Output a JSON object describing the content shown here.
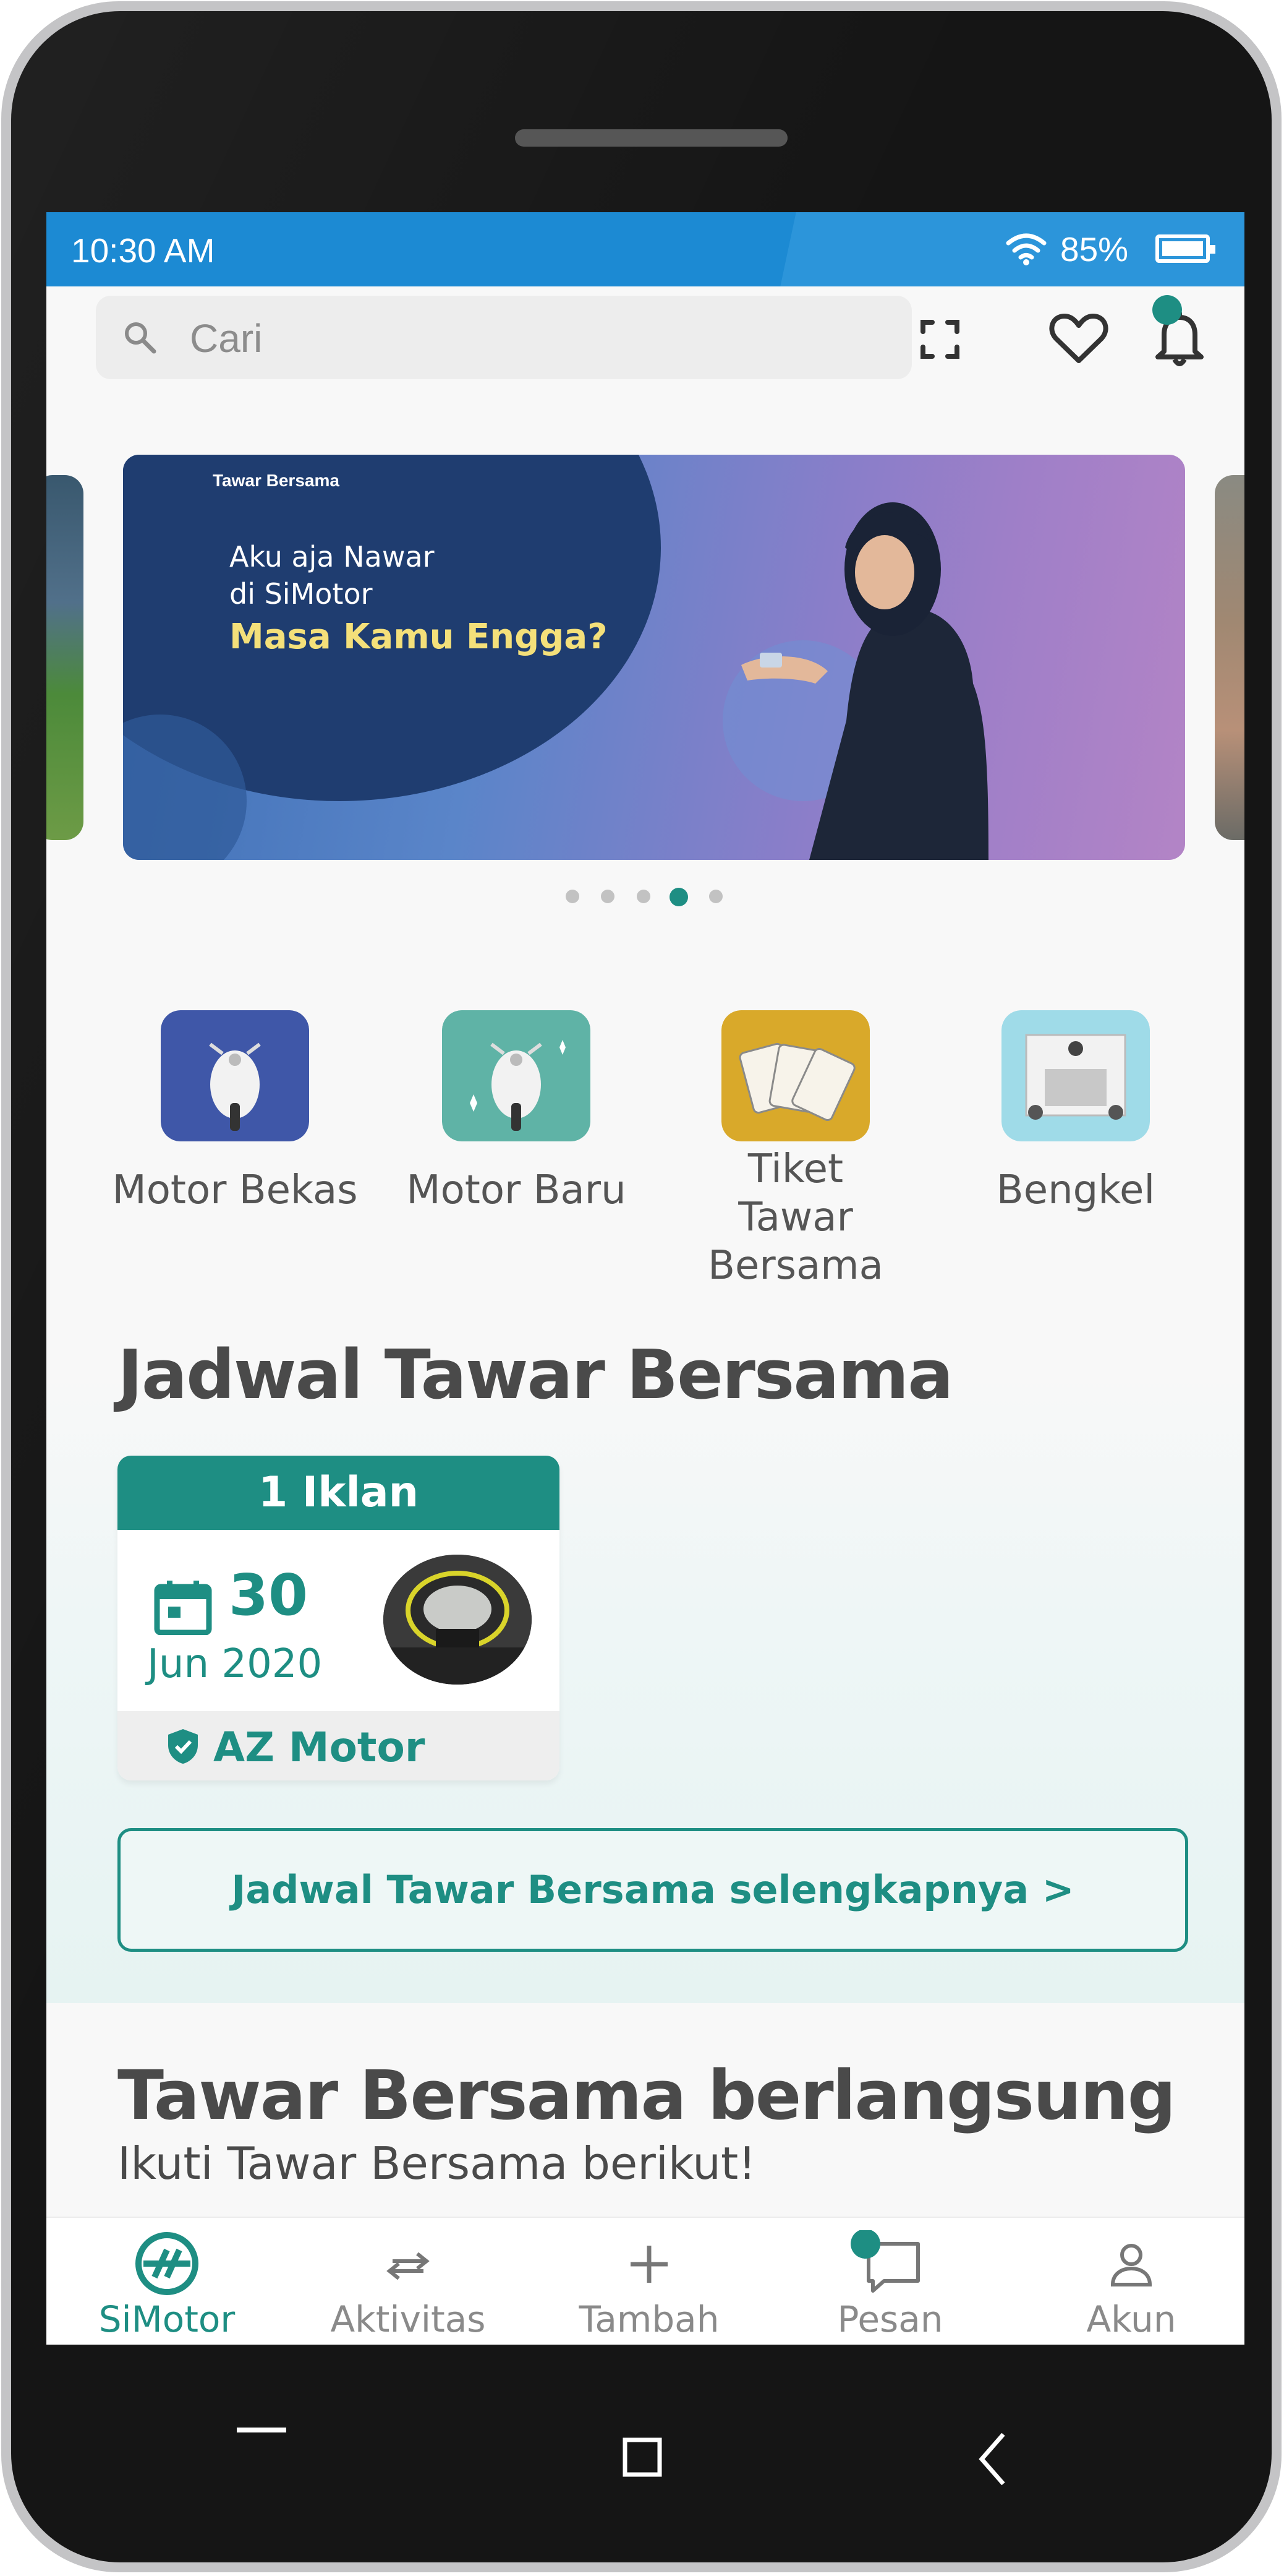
{
  "status_bar": {
    "time": "10:30 AM",
    "battery": "85%"
  },
  "search": {
    "placeholder": "Cari"
  },
  "header_icons": [
    "scan-icon",
    "heart-icon",
    "bell-icon"
  ],
  "banner": {
    "tag": "Tawar Bersama",
    "line1": "Aku aja Nawar",
    "line2": "di SiMotor",
    "line3": "Masa Kamu Engga?",
    "pages": 5,
    "active_page": 4
  },
  "categories": [
    {
      "label": "Motor Bekas",
      "icon": "scooter-icon"
    },
    {
      "label": "Motor Baru",
      "icon": "scooter-sparkle-icon"
    },
    {
      "label": "Tiket Tawar Bersama",
      "icon": "tickets-icon"
    },
    {
      "label": "Bengkel",
      "icon": "garage-icon"
    }
  ],
  "jadwal": {
    "title": "Jadwal Tawar Bersama",
    "card": {
      "count": "1 Iklan",
      "day": "30",
      "month": "Jun 2020",
      "dealer": "AZ Motor"
    },
    "more": "Jadwal Tawar Bersama selengkapnya >"
  },
  "berlangsung": {
    "title": "Tawar Bersama berlangsung",
    "subtitle": "Ikuti Tawar Bersama berikut!"
  },
  "bottom_nav": [
    {
      "label": "SiMotor",
      "icon": "simotor-logo-icon",
      "active": true
    },
    {
      "label": "Aktivitas",
      "icon": "arrows-icon"
    },
    {
      "label": "Tambah",
      "icon": "plus-icon"
    },
    {
      "label": "Pesan",
      "icon": "chat-icon"
    },
    {
      "label": "Akun",
      "icon": "person-icon"
    }
  ],
  "colors": {
    "accent": "#1e8e83",
    "status_bar": "#1c8ad3",
    "banner_highlight": "#f4e07a"
  }
}
